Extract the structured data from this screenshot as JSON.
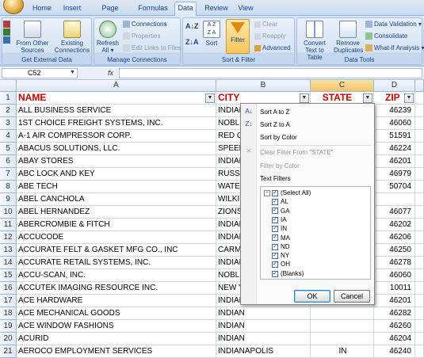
{
  "ribbon": {
    "tabs": [
      "Home",
      "Insert",
      "Page Layout",
      "Formulas",
      "Data",
      "Review",
      "View"
    ],
    "active_tab": "Data",
    "groups": {
      "external": {
        "label": "Get External Data",
        "from_other_sources": "From Other Sources",
        "existing_connections": "Existing Connections"
      },
      "connections": {
        "label": "Manage Connections",
        "refresh_all": "Refresh All",
        "connections": "Connections",
        "properties": "Properties",
        "edit_links": "Edit Links to Files"
      },
      "sortfilter": {
        "label": "Sort & Filter",
        "sort": "Sort",
        "filter": "Filter",
        "clear": "Clear",
        "reapply": "Reapply",
        "advanced": "Advanced"
      },
      "datatools": {
        "label": "Data Tools",
        "text_to_columns": "Convert Text to Table",
        "remove_duplicates": "Remove Duplicates",
        "data_validation": "Data Validation",
        "consolidate": "Consolidate",
        "what_if": "What-If Analysis"
      }
    }
  },
  "formula_bar": {
    "name_box": "C52",
    "fx": "fx",
    "content": ""
  },
  "grid": {
    "columns": [
      "A",
      "B",
      "C",
      "D"
    ],
    "selected_column": "C",
    "header_row": {
      "row": "1",
      "name": "NAME",
      "city": "CITY",
      "state": "STATE",
      "zip": "ZIP"
    },
    "rows": [
      {
        "row": "2",
        "name": "ALL BUSINESS SERVICE",
        "city": "INDIAN",
        "zip": "46239"
      },
      {
        "row": "3",
        "name": "1ST CHOICE FREIGHT SYSTEMS, INC.",
        "city": "NOBLE",
        "zip": "46060"
      },
      {
        "row": "4",
        "name": "A-1 AIR COMPRESSOR CORP.",
        "city": "RED O",
        "zip": "51591"
      },
      {
        "row": "5",
        "name": "ABACUS SOLUTIONS, LLC.",
        "city": "SPEED",
        "zip": "46224"
      },
      {
        "row": "6",
        "name": "ABAY STORES",
        "city": "INDIAN",
        "zip": "46201"
      },
      {
        "row": "7",
        "name": "ABC LOCK AND KEY",
        "city": "RUSS",
        "zip": "46979"
      },
      {
        "row": "8",
        "name": "ABE TECH",
        "city": "WATE",
        "zip": "50704"
      },
      {
        "row": "9",
        "name": "ABEL CANCHOLA",
        "city": "WILKI",
        "zip": ""
      },
      {
        "row": "10",
        "name": "ABEL HERNANDEZ",
        "city": "ZIONS",
        "zip": "46077"
      },
      {
        "row": "11",
        "name": "ABERCROMBIE & FITCH",
        "city": "INDIAN",
        "zip": "46202"
      },
      {
        "row": "12",
        "name": "ACCUCODE",
        "city": "INDIAN",
        "zip": "46206"
      },
      {
        "row": "13",
        "name": "ACCURATE FELT & GASKET MFG CO., INC",
        "city": "CARM",
        "zip": "46250"
      },
      {
        "row": "14",
        "name": "ACCURATE RETAIL SYSTEMS, INC.",
        "city": "INDIAN",
        "zip": "46278"
      },
      {
        "row": "15",
        "name": "ACCU-SCAN, INC.",
        "city": "NOBLE",
        "zip": "46060"
      },
      {
        "row": "16",
        "name": "ACCUTEK IMAGING RESOURCE INC.",
        "city": "NEW Y",
        "zip": "10011"
      },
      {
        "row": "17",
        "name": "ACE HARDWARE",
        "city": "INDIAN",
        "zip": "46201"
      },
      {
        "row": "18",
        "name": "ACE MECHANICAL GOODS",
        "city": "INDIAN",
        "zip": "46282"
      },
      {
        "row": "19",
        "name": "ACE WINDOW FASHIONS",
        "city": "INDIAN",
        "zip": "46260"
      },
      {
        "row": "20",
        "name": "ACURID",
        "city": "INDIAN",
        "zip": "46204"
      },
      {
        "row": "21",
        "name": "AEROCO EMPLOYMENT SERVICES",
        "city": "INDIANAPOLIS",
        "state": "IN",
        "zip": "46240"
      }
    ]
  },
  "filter_menu": {
    "sort_az": "Sort A to Z",
    "sort_za": "Sort Z to A",
    "sort_color": "Sort by Color",
    "clear_filter": "Clear Filter From \"STATE\"",
    "filter_color": "Filter by Color",
    "text_filters": "Text Filters",
    "options": [
      "(Select All)",
      "AL",
      "GA",
      "IA",
      "IN",
      "MA",
      "ND",
      "NY",
      "OH",
      "(Blanks)"
    ],
    "ok": "OK",
    "cancel": "Cancel"
  },
  "colors": {
    "header_text": "#c00000",
    "ribbon_text": "#15428b",
    "selected_col": "#f5c36a"
  }
}
